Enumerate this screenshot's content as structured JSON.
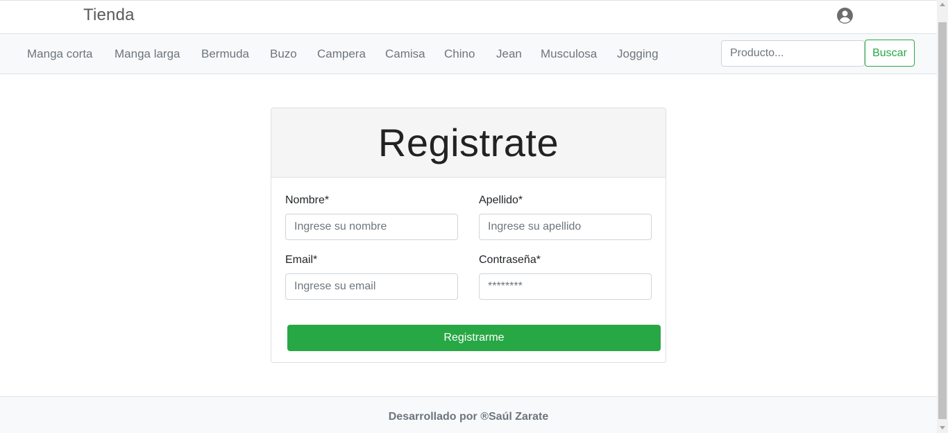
{
  "header": {
    "brand": "Tienda",
    "user_icon": "user-circle-icon"
  },
  "categories": [
    "Manga corta",
    "Manga larga",
    "Bermuda",
    "Buzo",
    "Campera",
    "Camisa",
    "Chino",
    "Jean",
    "Musculosa",
    "Jogging"
  ],
  "search": {
    "placeholder": "Producto...",
    "button_label": "Buscar"
  },
  "form": {
    "title": "Registrate",
    "nombre_label": "Nombre*",
    "nombre_placeholder": "Ingrese su nombre",
    "apellido_label": "Apellido*",
    "apellido_placeholder": "Ingrese su apellido",
    "email_label": "Email*",
    "email_placeholder": "Ingrese su email",
    "password_label": "Contraseña*",
    "password_placeholder": "********",
    "submit_label": "Registrarme"
  },
  "footer": {
    "text": "Desarrollado por ®Saúl Zarate"
  },
  "colors": {
    "accent": "#28a745",
    "navbar_bg": "#f8f9fa",
    "muted_text": "#6c757d"
  }
}
